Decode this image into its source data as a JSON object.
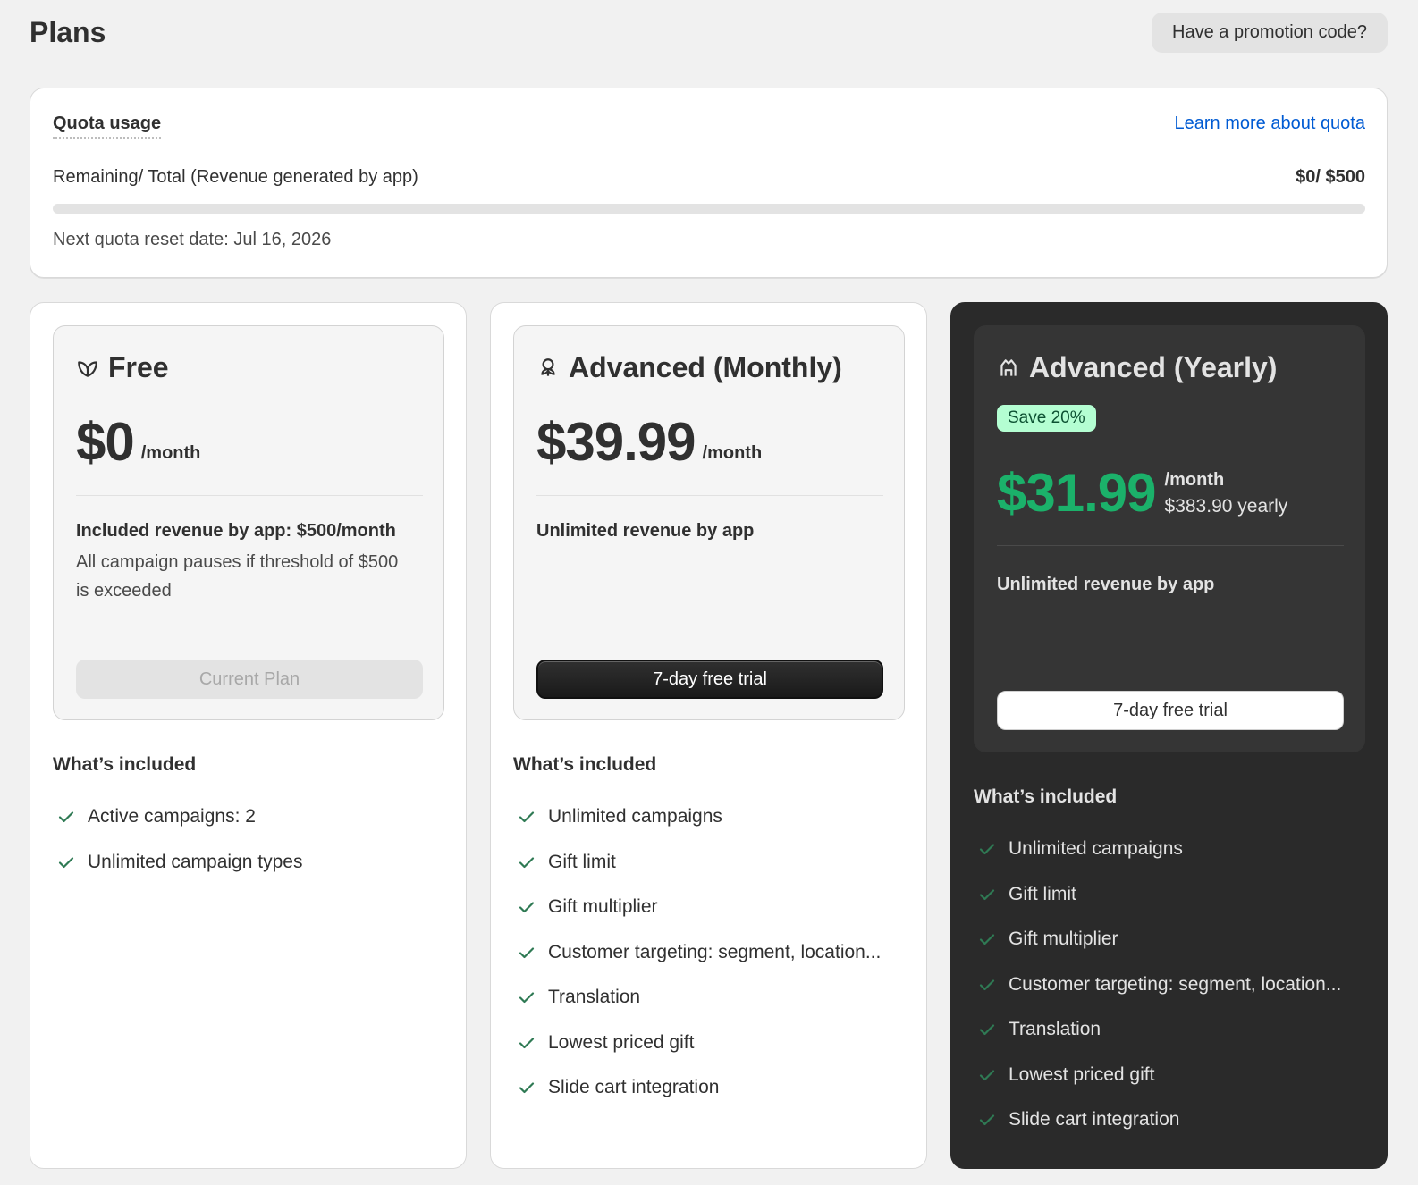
{
  "header": {
    "title": "Plans",
    "promo_label": "Have a promotion code?"
  },
  "quota": {
    "title": "Quota usage",
    "learn_more": "Learn more about quota",
    "label": "Remaining/ Total (Revenue generated by app)",
    "value": "$0/ $500",
    "used_fraction": 0,
    "reset_text": "Next quota reset date: Jul 16, 2026"
  },
  "colors": {
    "accent_green": "#1bb16a",
    "link_blue": "#005bd3",
    "dark_card": "#2a2a2a",
    "badge_bg": "#b4fed2"
  },
  "plans": [
    {
      "name": "Free",
      "icon": "leaf-icon",
      "price": "$0",
      "per": "/month",
      "revenue_title": "Included revenue by app: $500/month",
      "revenue_note": "All campaign pauses if threshold of $500 is exceeded",
      "button": "Current Plan",
      "included_title": "What’s included",
      "features": [
        "Active campaigns: 2",
        "Unlimited campaign types"
      ]
    },
    {
      "name": "Advanced (Monthly)",
      "icon": "flower-icon",
      "price": "$39.99",
      "per": "/month",
      "revenue_title": "Unlimited revenue by app",
      "button": "7-day free trial",
      "included_title": "What’s included",
      "features": [
        "Unlimited campaigns",
        "Gift limit",
        "Gift multiplier",
        "Customer targeting: segment, location...",
        "Translation",
        "Lowest priced gift",
        "Slide cart integration"
      ]
    },
    {
      "name": "Advanced (Yearly)",
      "icon": "crown-icon",
      "badge": "Save 20%",
      "price": "$31.99",
      "per": "/month",
      "yearly": "$383.90 yearly",
      "revenue_title": "Unlimited revenue by app",
      "button": "7-day free trial",
      "included_title": "What’s included",
      "features": [
        "Unlimited campaigns",
        "Gift limit",
        "Gift multiplier",
        "Customer targeting: segment, location...",
        "Translation",
        "Lowest priced gift",
        "Slide cart integration"
      ]
    }
  ]
}
